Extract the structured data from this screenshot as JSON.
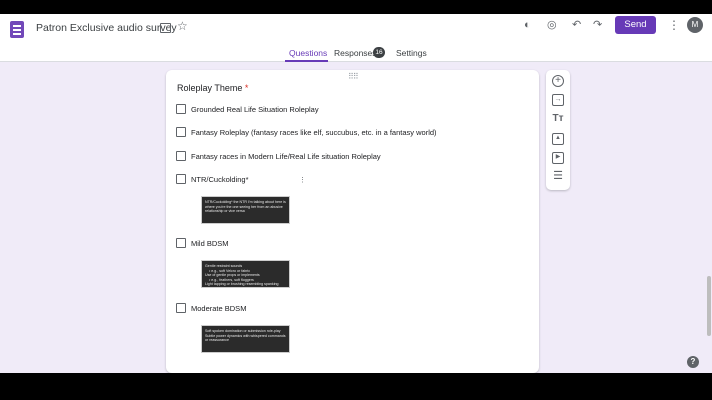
{
  "header": {
    "title": "Patron Exclusive audio survey",
    "send_label": "Send",
    "avatar_initial": "M",
    "icons": [
      "folder-icon",
      "star-icon",
      "palette-icon",
      "eye-icon",
      "undo-icon",
      "redo-icon",
      "more-vert-icon"
    ]
  },
  "tabs": {
    "questions": "Questions",
    "responses": "Responses",
    "responses_count": "16",
    "settings": "Settings"
  },
  "question": {
    "title": "Roleplay Theme",
    "required_mark": "*",
    "options": [
      {
        "label": "Grounded Real Life Situation Roleplay"
      },
      {
        "label": "Fantasy Roleplay (fantasy races like elf, succubus, etc. in a fantasy world)"
      },
      {
        "label": "Fantasy races in Modern Life/Real Life situation Roleplay"
      },
      {
        "label": "NTR/Cuckolding*"
      },
      {
        "label": "Mild BDSM"
      },
      {
        "label": "Moderate BDSM"
      }
    ],
    "images": [
      {
        "text": "NTR/Cuckolding* the NTR I'm talking about here is\nwhere you're the one seeing her from an abusive\nrelationship or vice versa"
      },
      {
        "text": "Gentle restraint sounds\n    • e.g., soft Velcro or fabric\nUse of gentle props or implements\n    • e.g., feathers, soft floggers\nLight tapping or brushing resembling spanking"
      },
      {
        "text": "Soft spoken domination or submission role-play\nSubtle power dynamics with whispered commands\nor reassurance"
      }
    ]
  },
  "toolbar": {
    "items": [
      "add-question-icon",
      "import-questions-icon",
      "add-title-icon",
      "add-image-icon",
      "add-video-icon",
      "add-section-icon"
    ]
  },
  "colors": {
    "accent": "#673ab7",
    "background": "#f0ebf8"
  }
}
